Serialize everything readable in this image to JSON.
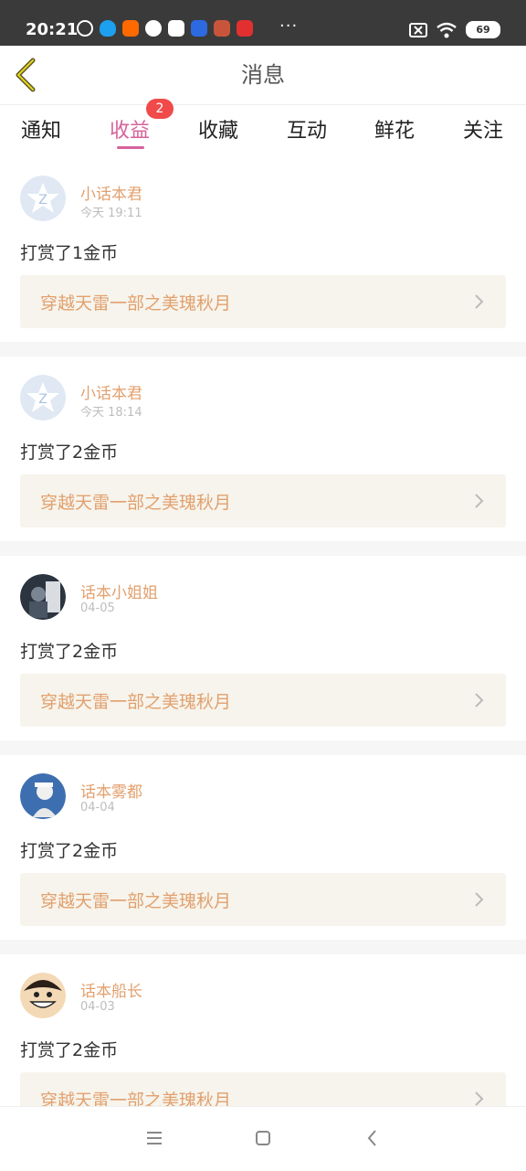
{
  "status_bar": {
    "time": "20:21",
    "battery": "69",
    "app_icons": [
      {
        "name": "swirl-app-icon",
        "color": "#3a3a3a"
      },
      {
        "name": "qq-icon",
        "color": "#1ea0f0"
      },
      {
        "name": "mi-icon",
        "color": "#ff6a00"
      },
      {
        "name": "check-app-icon",
        "color": "#ffffff"
      },
      {
        "name": "chrome-like-icon",
        "color": "#ffffff"
      },
      {
        "name": "baidu-icon",
        "color": "#2d6ae0"
      },
      {
        "name": "game-app-icon",
        "color": "#c8553b"
      },
      {
        "name": "netease-icon",
        "color": "#e23030"
      }
    ],
    "more_dots": "···"
  },
  "header": {
    "title": "消息"
  },
  "tabs": [
    {
      "label": "通知"
    },
    {
      "label": "收益",
      "active": true,
      "badge": "2"
    },
    {
      "label": "收藏"
    },
    {
      "label": "互动"
    },
    {
      "label": "鲜花"
    },
    {
      "label": "关注"
    }
  ],
  "colors": {
    "accent": "#d6629b",
    "name": "#e2a06e",
    "badge": "#f04a4a"
  },
  "items": [
    {
      "user": "小话本君",
      "time": "今天 19:11",
      "message": "打赏了1金币",
      "book": "穿越天雷一部之美瑰秋月",
      "avatar": "star-avatar-icon"
    },
    {
      "user": "小话本君",
      "time": "今天 18:14",
      "message": "打赏了2金币",
      "book": "穿越天雷一部之美瑰秋月",
      "avatar": "star-avatar-icon"
    },
    {
      "user": "话本小姐姐",
      "time": "04-05",
      "message": "打赏了2金币",
      "book": "穿越天雷一部之美瑰秋月",
      "avatar": "photo-avatar"
    },
    {
      "user": "话本雾都",
      "time": "04-04",
      "message": "打赏了2金币",
      "book": "穿越天雷一部之美瑰秋月",
      "avatar": "photo-avatar"
    },
    {
      "user": "话本船长",
      "time": "04-03",
      "message": "打赏了2金币",
      "book": "穿越天雷一部之美瑰秋月",
      "avatar": "cartoon-avatar"
    }
  ]
}
